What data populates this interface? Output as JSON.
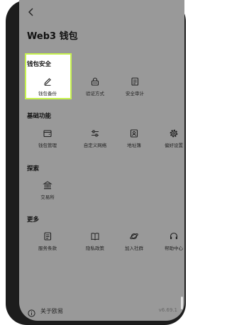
{
  "header": {
    "title": "Web3 钱包"
  },
  "sections": [
    {
      "title": "钱包安全",
      "items": [
        {
          "label": "钱包备份",
          "icon": "pencil-icon"
        },
        {
          "label": "验证方式",
          "icon": "lock-icon"
        },
        {
          "label": "安全审计",
          "icon": "audit-doc-icon"
        }
      ]
    },
    {
      "title": "基础功能",
      "items": [
        {
          "label": "钱包管理",
          "icon": "wallet-icon"
        },
        {
          "label": "自定义网络",
          "icon": "sliders-icon"
        },
        {
          "label": "地址簿",
          "icon": "address-book-icon"
        },
        {
          "label": "偏好设置",
          "icon": "gear-icon"
        }
      ]
    },
    {
      "title": "探索",
      "items": [
        {
          "label": "交易所",
          "icon": "bank-icon"
        }
      ]
    },
    {
      "title": "更多",
      "items": [
        {
          "label": "服务条款",
          "icon": "terms-doc-icon"
        },
        {
          "label": "隐私政策",
          "icon": "book-icon"
        },
        {
          "label": "加入社群",
          "icon": "planet-icon"
        },
        {
          "label": "帮助中心",
          "icon": "headset-icon"
        }
      ]
    }
  ],
  "footer": {
    "label": "关于欧易",
    "version": "v6.69.1"
  }
}
